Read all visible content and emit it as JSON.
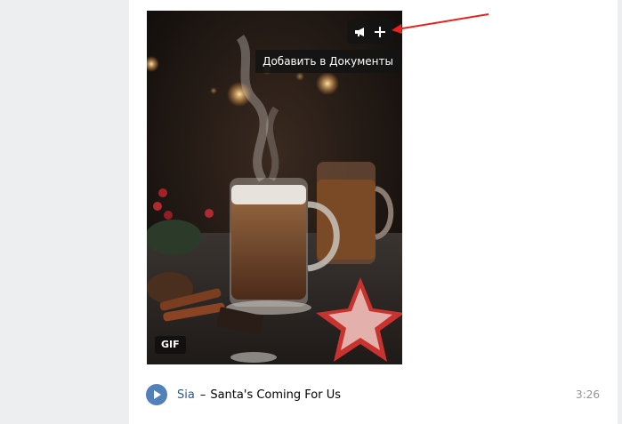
{
  "gif": {
    "tooltip": "Добавить в Документы",
    "badge": "GIF",
    "actions": [
      "megaphone-icon",
      "plus-icon"
    ]
  },
  "audio": {
    "artist": "Sia",
    "separator": "–",
    "title": "Santa's Coming For Us",
    "duration": "3:26"
  },
  "colors": {
    "page_bg": "#edeef0",
    "card_bg": "#ffffff",
    "link": "#2a5885",
    "play_button": "#5181b8",
    "annotation_arrow": "#e8231f",
    "duration": "#939393"
  }
}
